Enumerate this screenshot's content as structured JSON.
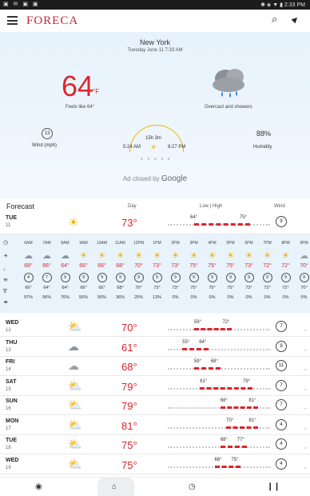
{
  "status": {
    "left": "▣ ✉ ▣ ▣",
    "right": "✱ ◈ ▼ ▮ 2:33 PM"
  },
  "app": {
    "logo": "FORECA"
  },
  "hero": {
    "city": "New York",
    "datetime": "Tuesday June 11 7:33 AM",
    "temp": "64",
    "unit": "°F",
    "feels": "Feels like 64°",
    "condition": "Overcast and showers",
    "wind_value": "13",
    "wind_label": "Wind (mph)",
    "day_length": "15h 3m",
    "sunrise": "5:24 AM",
    "sunset": "8:27 PM",
    "humidity": "88%",
    "humidity_label": "Humidity",
    "ad_text": "Ad closed by",
    "ad_brand": "Google"
  },
  "forecast_header": {
    "title": "Forecast",
    "day": "Day",
    "lowhigh": "Low | High",
    "wind": "Wind"
  },
  "today": {
    "name": "TUE",
    "date": "11",
    "icon": "sun-icon",
    "temp": "73°",
    "low": "64°",
    "high": "75°",
    "wind": "9"
  },
  "hourly": [
    {
      "time": "6AM",
      "icon": "cloud-rain",
      "temp": "68°",
      "wind": "4",
      "dew": "66°",
      "pop": "97%"
    },
    {
      "time": "7AM",
      "icon": "cloud-rain",
      "temp": "66°",
      "wind": "7",
      "dew": "64°",
      "pop": "96%"
    },
    {
      "time": "8AM",
      "icon": "cloud-rain",
      "temp": "64°",
      "wind": "9",
      "dew": "64°",
      "pop": "76%"
    },
    {
      "time": "9AM",
      "icon": "sun",
      "temp": "66°",
      "wind": "9",
      "dew": "66°",
      "pop": "56%"
    },
    {
      "time": "10AM",
      "icon": "sun",
      "temp": "66°",
      "wind": "9",
      "dew": "66°",
      "pop": "56%"
    },
    {
      "time": "11AM",
      "icon": "sun",
      "temp": "68°",
      "wind": "9",
      "dew": "68°",
      "pop": "36%"
    },
    {
      "time": "12PM",
      "icon": "sun",
      "temp": "70°",
      "wind": "9",
      "dew": "70°",
      "pop": "25%"
    },
    {
      "time": "1PM",
      "icon": "sun",
      "temp": "73°",
      "wind": "9",
      "dew": "73°",
      "pop": "13%"
    },
    {
      "time": "2PM",
      "icon": "sun",
      "temp": "73°",
      "wind": "9",
      "dew": "73°",
      "pop": "0%"
    },
    {
      "time": "3PM",
      "icon": "sun",
      "temp": "75°",
      "wind": "9",
      "dew": "75°",
      "pop": "0%"
    },
    {
      "time": "4PM",
      "icon": "sun",
      "temp": "75°",
      "wind": "9",
      "dew": "75°",
      "pop": "0%"
    },
    {
      "time": "5PM",
      "icon": "sun",
      "temp": "75°",
      "wind": "9",
      "dew": "75°",
      "pop": "0%"
    },
    {
      "time": "6PM",
      "icon": "sun",
      "temp": "73°",
      "wind": "9",
      "dew": "73°",
      "pop": "0%"
    },
    {
      "time": "7PM",
      "icon": "sun",
      "temp": "72°",
      "wind": "9",
      "dew": "72°",
      "pop": "0%"
    },
    {
      "time": "8PM",
      "icon": "sun",
      "temp": "72°",
      "wind": "9",
      "dew": "72°",
      "pop": "0%"
    },
    {
      "time": "9PM",
      "icon": "cloud",
      "temp": "70°",
      "wind": "9",
      "dew": "70°",
      "pop": "0%"
    }
  ],
  "days": [
    {
      "name": "WED",
      "date": "12",
      "icon": "partly-cloudy",
      "temp": "70°",
      "low": "59°",
      "high": "72°",
      "wind": "7",
      "lo_v": 59,
      "hi_v": 72
    },
    {
      "name": "THU",
      "date": "13",
      "icon": "cloud-rain",
      "temp": "61°",
      "low": "55°",
      "high": "64°",
      "wind": "9",
      "lo_v": 55,
      "hi_v": 64
    },
    {
      "name": "FRI",
      "date": "14",
      "icon": "cloud",
      "temp": "68°",
      "low": "59°",
      "high": "68°",
      "wind": "11",
      "lo_v": 59,
      "hi_v": 68
    },
    {
      "name": "SAT",
      "date": "15",
      "icon": "partly-cloudy",
      "temp": "79°",
      "low": "61°",
      "high": "79°",
      "wind": "7",
      "lo_v": 61,
      "hi_v": 79
    },
    {
      "name": "SUN",
      "date": "16",
      "icon": "partly-cloudy",
      "temp": "79°",
      "low": "68°",
      "high": "81°",
      "wind": "7",
      "lo_v": 68,
      "hi_v": 81
    },
    {
      "name": "MON",
      "date": "17",
      "icon": "partly-cloudy-rain",
      "temp": "81°",
      "low": "70°",
      "high": "81°",
      "wind": "4",
      "lo_v": 70,
      "hi_v": 81
    },
    {
      "name": "TUE",
      "date": "18",
      "icon": "partly-cloudy-rain",
      "temp": "75°",
      "low": "68°",
      "high": "77°",
      "wind": "4",
      "lo_v": 68,
      "hi_v": 77
    },
    {
      "name": "WED",
      "date": "19",
      "icon": "partly-cloudy-rain",
      "temp": "75°",
      "low": "66°",
      "high": "75°",
      "wind": "4",
      "lo_v": 66,
      "hi_v": 75
    }
  ],
  "colors": {
    "accent": "#d9252b",
    "sun": "#f0b400"
  }
}
